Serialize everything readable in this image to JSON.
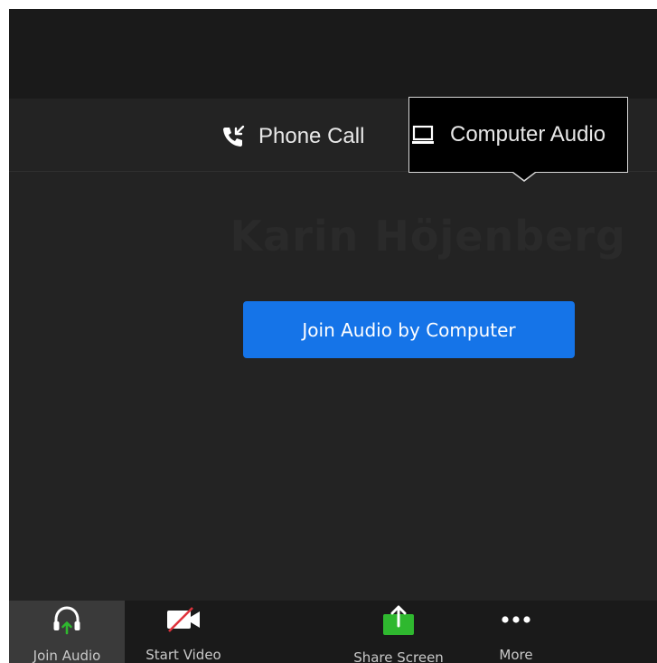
{
  "audio_tabs": {
    "phone_call": {
      "label": "Phone Call",
      "icon": "phone-call-icon"
    },
    "computer_audio": {
      "label": "Computer Audio",
      "icon": "monitor-icon"
    }
  },
  "participant": {
    "name": "Karin Höjenberg"
  },
  "join_button": {
    "label": "Join Audio by Computer",
    "color": "#1574e8"
  },
  "toolbar": {
    "join_audio": {
      "label": "Join Audio",
      "icon": "headphones-icon"
    },
    "start_video": {
      "label": "Start Video",
      "icon": "video-off-icon"
    },
    "share_screen": {
      "label": "Share Screen",
      "icon": "share-screen-icon",
      "color": "#2fb82f"
    },
    "more": {
      "label": "More",
      "icon": "more-icon"
    }
  }
}
